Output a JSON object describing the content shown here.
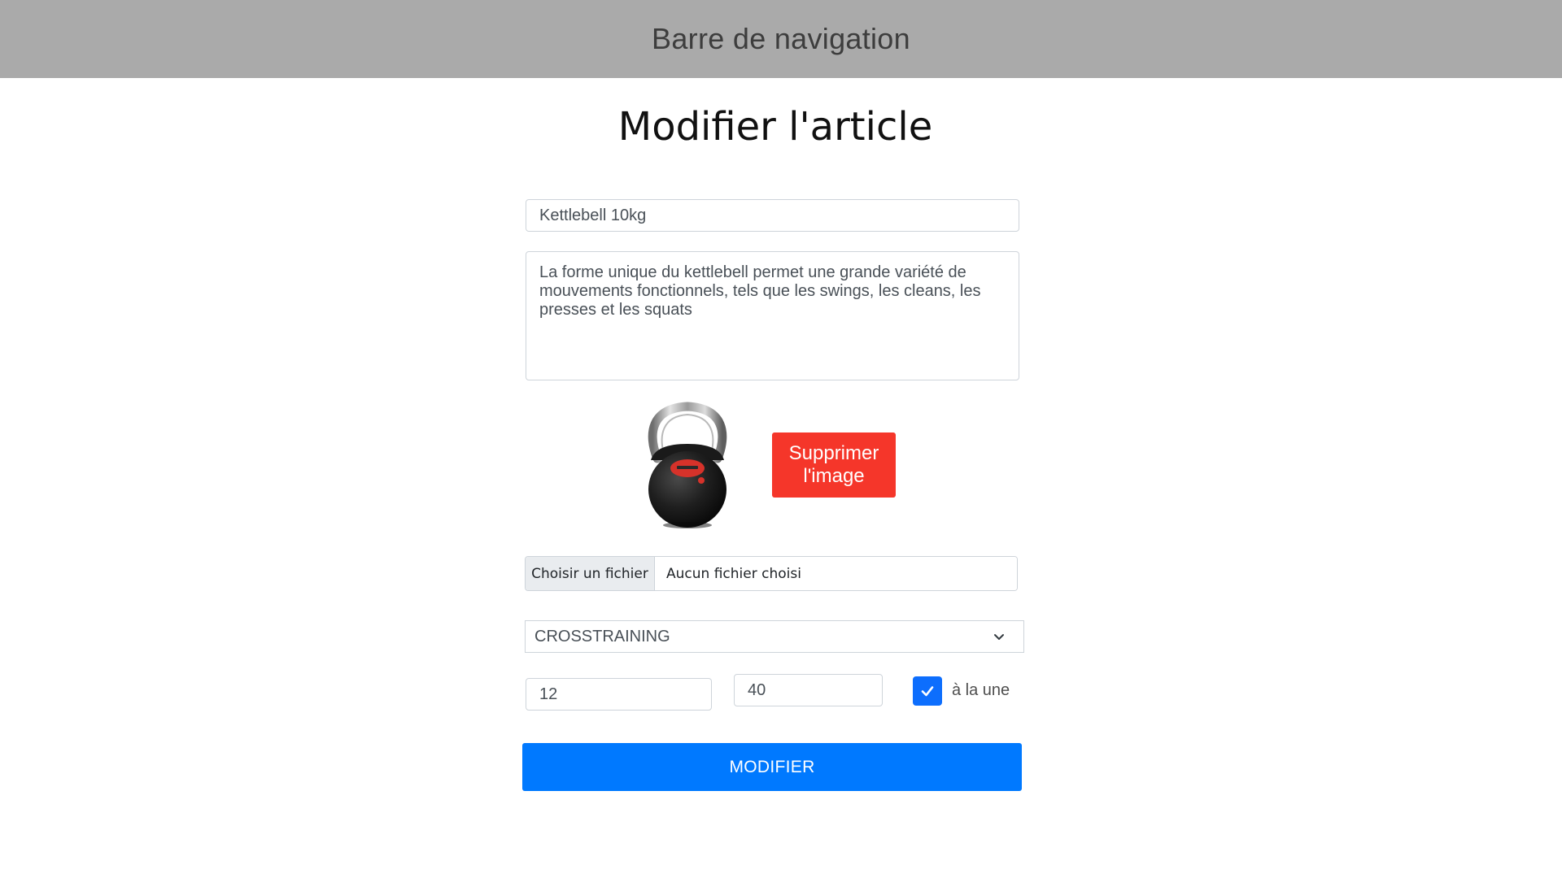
{
  "navbar": {
    "title": "Barre de navigation"
  },
  "page": {
    "title": "Modifier l'article"
  },
  "form": {
    "name_value": "Kettlebell 10kg",
    "description_value": "La forme unique du kettlebell permet une grande variété de mouvements fonctionnels, tels que les swings, les cleans, les presses et les squats",
    "delete_image_label": "Supprimer l'image",
    "file": {
      "button_label": "Choisir un fichier",
      "status": "Aucun fichier choisi"
    },
    "category": {
      "selected": "CROSSTRAINING",
      "icon": "chevron-down-icon"
    },
    "quantity_value": "12",
    "price_value": "40",
    "featured": {
      "checked": true,
      "label": "à la une",
      "icon": "check-icon"
    },
    "submit_label": "MODIFIER"
  },
  "image": {
    "subject": "kettlebell-photo"
  },
  "colors": {
    "navbar_bg": "#aaaaaa",
    "delete_button": "#f5362a",
    "submit_button": "#0079ff",
    "checkbox": "#0d6efd"
  }
}
